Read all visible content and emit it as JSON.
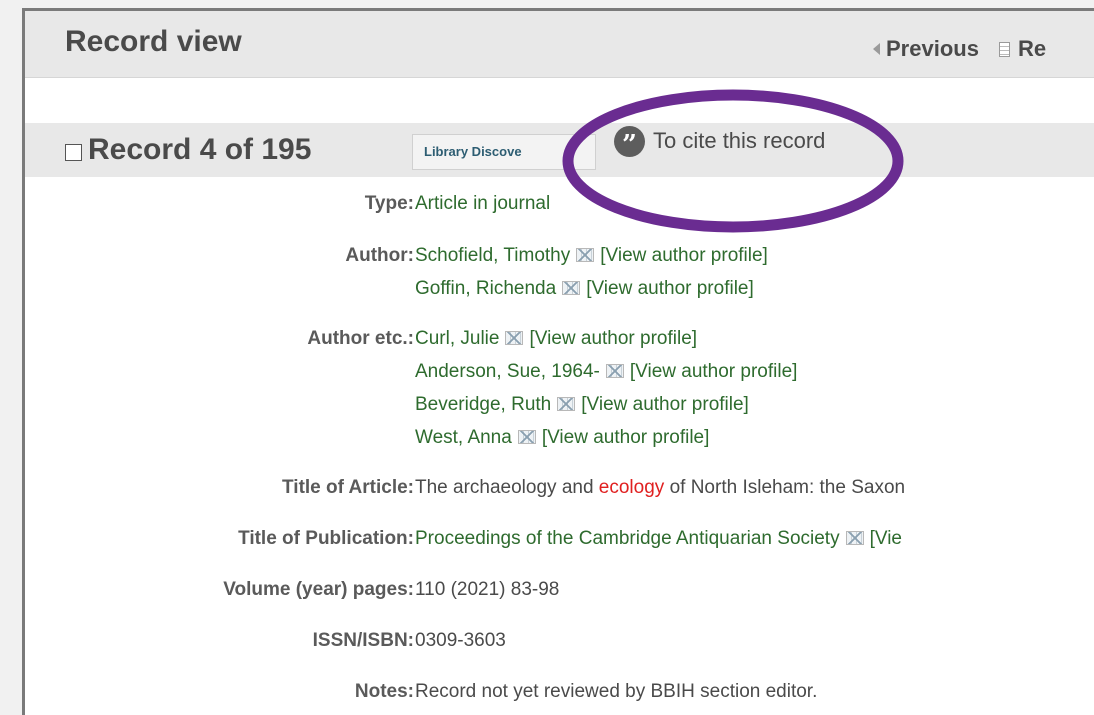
{
  "header": {
    "title": "Record view",
    "previous_label": "Previous",
    "next_partial_label": "Re"
  },
  "record": {
    "count_label": "Record 4 of 195",
    "library_button_label": "Library Discove",
    "cite_icon_glyph": "”",
    "cite_label": "To cite this record"
  },
  "fields": {
    "type": {
      "label": "Type:",
      "value": "Article in journal"
    },
    "author": {
      "label": "Author:",
      "entries": [
        {
          "name": "Schofield, Timothy",
          "profile": "[View author profile]"
        },
        {
          "name": "Goffin, Richenda",
          "profile": "[View author profile]"
        }
      ]
    },
    "author_etc": {
      "label": "Author etc.:",
      "entries": [
        {
          "name": "Curl, Julie",
          "profile": "[View author profile]"
        },
        {
          "name": "Anderson, Sue, 1964-",
          "profile": "[View author profile]"
        },
        {
          "name": "Beveridge, Ruth",
          "profile": "[View author profile]"
        },
        {
          "name": "West, Anna",
          "profile": "[View author profile]"
        }
      ]
    },
    "title_of_article": {
      "label": "Title of Article:",
      "before": "The archaeology and ",
      "highlight": "ecology",
      "after": " of North Isleham: the Saxon"
    },
    "title_of_publication": {
      "label": "Title of Publication:",
      "value": "Proceedings of the Cambridge Antiquarian Society",
      "profile_partial": "[Vie"
    },
    "volume": {
      "label": "Volume (year) pages:",
      "value": "110 (2021) 83-98"
    },
    "issn": {
      "label": "ISSN/ISBN:",
      "value": "0309-3603"
    },
    "notes": {
      "label": "Notes:",
      "value": "Record not yet reviewed by BBIH section editor."
    }
  },
  "colors": {
    "link_green": "#2e6b2e",
    "highlight_red": "#e02020",
    "annotation_purple": "#6a2c91"
  },
  "annotation": {
    "shape": "ellipse",
    "encircles": "cite-link"
  }
}
